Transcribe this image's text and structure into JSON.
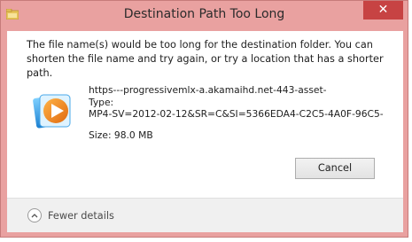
{
  "window": {
    "title": "Destination Path Too Long",
    "close_glyph": "✕",
    "frame_color": "#e9a1a0",
    "close_button_color": "#c74343"
  },
  "message": {
    "text": "The file name(s) would be too long for the destination folder. You can shorten the file name and try again, or try a location that has a shorter path."
  },
  "file": {
    "icon": "windows-media-player-icon",
    "name": "https---progressivemlx-a.akamaihd.net-443-asset-",
    "type_label": "Type:",
    "type_value": "MP4-SV=2012-02-12&SR=C&SI=5366EDA4-C2C5-4A0F-96C5-",
    "size": "Size: 98.0 MB"
  },
  "actions": {
    "cancel_label": "Cancel"
  },
  "footer": {
    "fewer_details_label": "Fewer details",
    "icon": "chevron-up-icon"
  }
}
